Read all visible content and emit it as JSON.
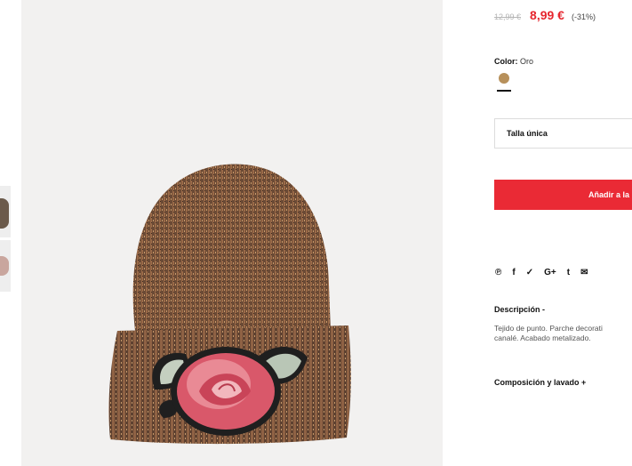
{
  "product": {
    "image_alt": "Gorro de punto dorado con parche de rosa",
    "old_price": "12,99 €",
    "price": "8,99 €",
    "discount": "(-31%)"
  },
  "color": {
    "label": "Color:",
    "value": "Oro",
    "swatch_hex": "#b7905b"
  },
  "size": {
    "selected": "Talla única"
  },
  "cart": {
    "button_label": "Añadir a la"
  },
  "share": {
    "icons": [
      "P",
      "f",
      "t",
      "G+",
      "t",
      "m"
    ],
    "icon_names": [
      "pinterest-icon",
      "facebook-icon",
      "twitter-icon",
      "google-plus-icon",
      "tumblr-icon",
      "email-icon"
    ]
  },
  "description": {
    "title": "Descripción -",
    "line1": "Tejido de punto. Parche decorati",
    "line2": "canalé. Acabado metalizado."
  },
  "composition": {
    "title": "Composición y lavado +"
  },
  "colors": {
    "price_red": "#e6262e",
    "button_red": "#ea2a35"
  }
}
